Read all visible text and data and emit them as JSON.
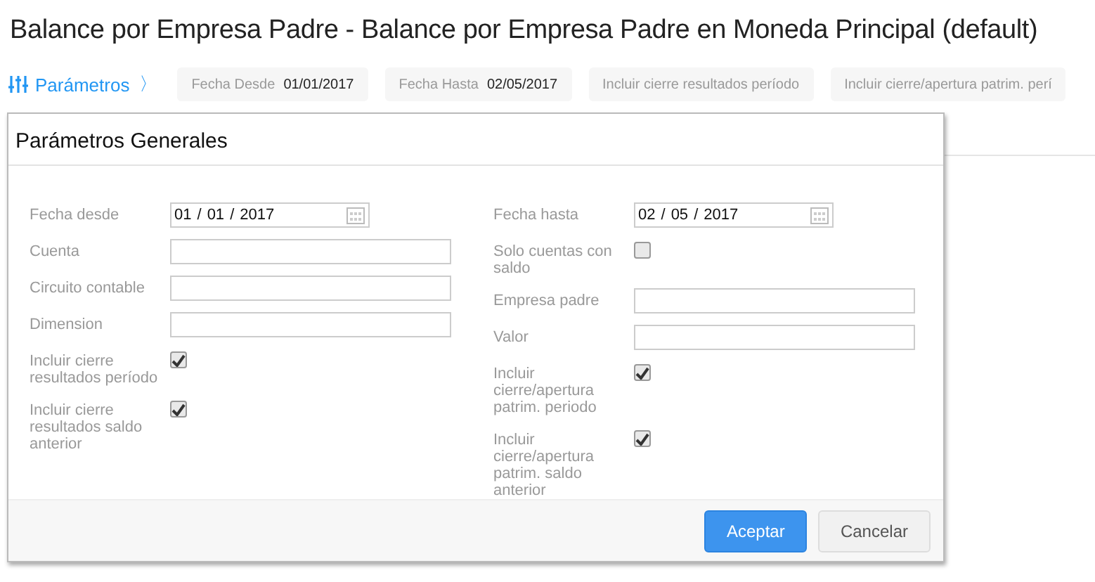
{
  "title": "Balance por Empresa Padre - Balance por Empresa Padre en Moneda Principal (default)",
  "filter_bar": {
    "toggle": {
      "label": "Parámetros",
      "chevron": "〉",
      "expanded": true
    },
    "chips": [
      {
        "label": "Fecha Desde",
        "value": "01/01/2017"
      },
      {
        "label": "Fecha Hasta",
        "value": "02/05/2017"
      },
      {
        "label": "Incluir cierre resultados período"
      },
      {
        "label": "Incluir cierre/apertura patrim. perí"
      }
    ]
  },
  "panel": {
    "title": "Parámetros Generales",
    "columns": [
      [
        {
          "kind": "date",
          "label": "Fecha desde",
          "parts": [
            "01",
            "01",
            "2017"
          ],
          "separator": "/"
        },
        {
          "kind": "text",
          "label": "Cuenta"
        },
        {
          "kind": "text",
          "label": "Circuito contable"
        },
        {
          "kind": "text",
          "label": "Dimension"
        },
        {
          "kind": "checkbox",
          "label": "Incluir cierre resultados período",
          "checked": true
        },
        {
          "kind": "checkbox",
          "label": "Incluir cierre resultados saldo anterior",
          "checked": true
        }
      ],
      [
        {
          "kind": "date",
          "label": "Fecha hasta",
          "parts": [
            "02",
            "05",
            "2017"
          ],
          "separator": "/"
        },
        {
          "kind": "checkbox",
          "label": "Solo cuentas con saldo",
          "checked": false
        },
        {
          "kind": "text",
          "label": "Empresa padre"
        },
        {
          "kind": "text",
          "label": "Valor"
        },
        {
          "kind": "checkbox",
          "label": "Incluir cierre/apertura patrim. periodo",
          "checked": true
        },
        {
          "kind": "checkbox",
          "label": "Incluir cierre/apertura patrim. saldo anterior",
          "checked": true
        }
      ]
    ],
    "buttons": [
      {
        "label": "Aceptar",
        "primary": true
      },
      {
        "label": "Cancelar",
        "primary": false
      }
    ]
  }
}
